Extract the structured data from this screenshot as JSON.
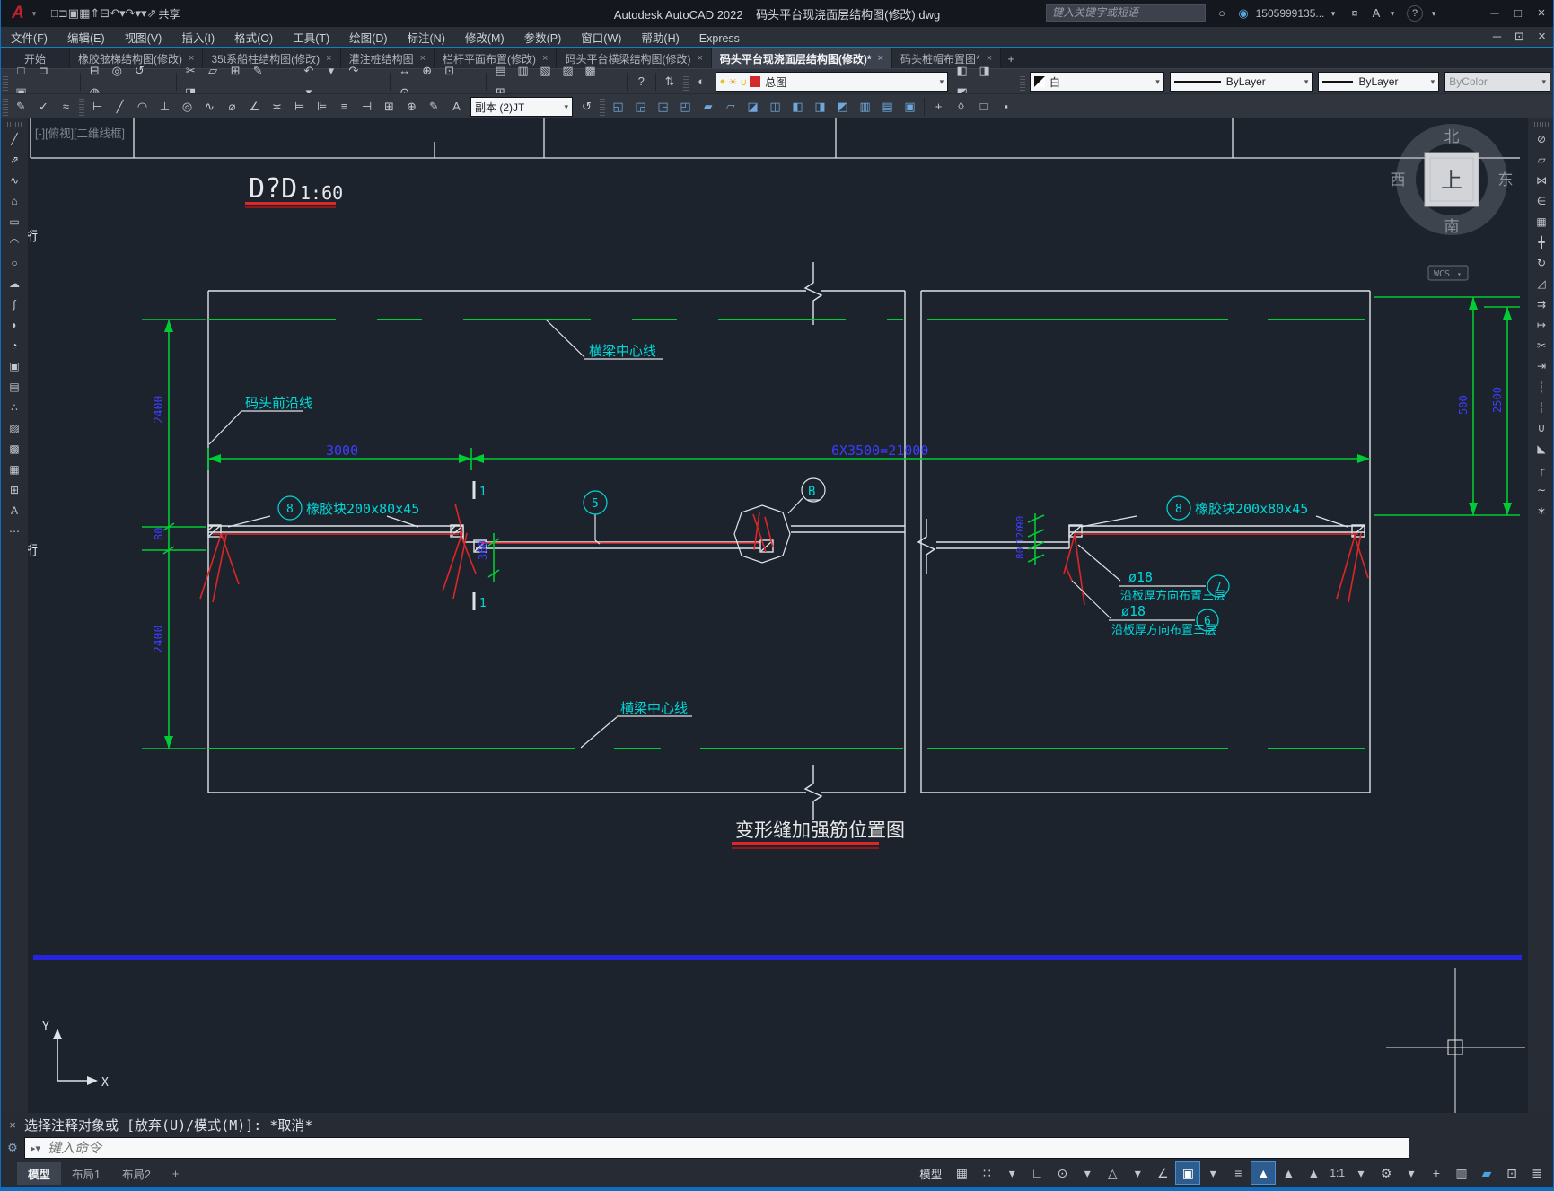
{
  "titlebar": {
    "app_title": "Autodesk AutoCAD 2022",
    "doc_title": "码头平台现浇面层结构图(修改).dwg",
    "share_label": "共享",
    "search_placeholder": "键入关键字或短语",
    "account": "1505999135...",
    "quick_icons": [
      {
        "n": "new-icon",
        "g": "□"
      },
      {
        "n": "open-icon",
        "g": "⊐"
      },
      {
        "n": "save-icon",
        "g": "▣"
      },
      {
        "n": "save-as-icon",
        "g": "▦"
      },
      {
        "n": "export-icon",
        "g": "⇑"
      },
      {
        "n": "plot-icon",
        "g": "⊟"
      },
      {
        "n": "undo-icon",
        "g": "↶"
      },
      {
        "n": "undo-caret-icon",
        "g": "▾"
      },
      {
        "n": "redo-icon",
        "g": "↷"
      },
      {
        "n": "redo-caret-icon",
        "g": "▾"
      },
      {
        "n": "quick-access-caret-icon",
        "g": "▾"
      },
      {
        "n": "share-icon",
        "g": "⇗"
      }
    ],
    "search_icon": "○",
    "account_icon": "◉",
    "cart_icon": "¤",
    "app-store-icon": "A",
    "help_icon": "?",
    "min": "─",
    "max": "□",
    "close": "×"
  },
  "menu": {
    "items": [
      "文件(F)",
      "编辑(E)",
      "视图(V)",
      "插入(I)",
      "格式(O)",
      "工具(T)",
      "绘图(D)",
      "标注(N)",
      "修改(M)",
      "参数(P)",
      "窗口(W)",
      "帮助(H)",
      "Express"
    ],
    "doc_min": "─",
    "doc_restore": "⊡",
    "doc_close": "×"
  },
  "doc_tabs": {
    "close_glyph": "×",
    "tabs": [
      {
        "label": "开始"
      },
      {
        "label": "橡胶舷梯结构图(修改)"
      },
      {
        "label": "35t系船柱结构图(修改)"
      },
      {
        "label": "灌注桩结构图"
      },
      {
        "label": "栏杆平面布置(修改)"
      },
      {
        "label": "码头平台横梁结构图(修改)"
      },
      {
        "label": "码头平台现浇面层结构图(修改)*"
      },
      {
        "label": "码头桩帽布置图*"
      }
    ],
    "new_tab": "+"
  },
  "toolbar1": {
    "g_file": [
      {
        "n": "new-icon",
        "g": "□"
      },
      {
        "n": "open-icon",
        "g": "⊐"
      },
      {
        "n": "save-icon",
        "g": "▣"
      }
    ],
    "g_plot": [
      {
        "n": "plot-icon",
        "g": "⊟"
      },
      {
        "n": "plot-preview-icon",
        "g": "◎"
      },
      {
        "n": "publish-icon",
        "g": "↺"
      },
      {
        "n": "share-view-icon",
        "g": "◍"
      }
    ],
    "g_clip": [
      {
        "n": "cut-icon",
        "g": "✂"
      },
      {
        "n": "copy-clip-icon",
        "g": "▱"
      },
      {
        "n": "paste-icon",
        "g": "⊞"
      },
      {
        "n": "match-properties-icon",
        "g": "✎"
      },
      {
        "n": "block-editor-icon",
        "g": "◨"
      }
    ],
    "g_undo": [
      {
        "n": "undo-icon",
        "g": "↶"
      },
      {
        "n": "undo-caret-icon",
        "g": "▾"
      },
      {
        "n": "redo-icon",
        "g": "↷"
      },
      {
        "n": "redo-caret-icon",
        "g": "▾"
      }
    ],
    "g_zoom": [
      {
        "n": "pan-icon",
        "g": "↔"
      },
      {
        "n": "zoom-realtime-icon",
        "g": "⊕"
      },
      {
        "n": "zoom-window-icon",
        "g": "⊡"
      },
      {
        "n": "zoom-previous-icon",
        "g": "⊙"
      }
    ],
    "g_palettes": [
      {
        "n": "layer-properties-icon",
        "g": "▤"
      },
      {
        "n": "layer-states-icon",
        "g": "▥"
      },
      {
        "n": "properties-palette-icon",
        "g": "▧"
      },
      {
        "n": "tool-palettes-icon",
        "g": "▨"
      },
      {
        "n": "sheet-set-icon",
        "g": "▩"
      },
      {
        "n": "quickcalc-icon",
        "g": "⊞"
      }
    ],
    "g_help": [
      {
        "n": "help-icon",
        "g": "?"
      }
    ],
    "g_sync": [
      {
        "n": "sync-icon",
        "g": "⇅"
      }
    ],
    "g_layer_tool": [
      {
        "n": "make-object-layer-current-icon",
        "g": "◐"
      }
    ],
    "layer_combo": {
      "bulb": "●",
      "sun": "☀",
      "lock": "∪",
      "value": "总图",
      "swatch_color": "#d42a2a"
    },
    "g_layer_tools2": [
      {
        "n": "layer-match-icon",
        "g": "◧"
      },
      {
        "n": "layer-previous-icon",
        "g": "◨"
      },
      {
        "n": "layer-isolate-icon",
        "g": "◩"
      }
    ],
    "color_combo": {
      "value": "白"
    },
    "linetype_combo": {
      "value": "ByLayer"
    },
    "lineweight_combo": {
      "value": "ByLayer"
    },
    "plotstyle_combo": {
      "value": "ByColor"
    }
  },
  "toolbar2": {
    "g_text": [
      {
        "n": "text-edit-icon",
        "g": "✎"
      },
      {
        "n": "spell-check-icon",
        "g": "✓"
      },
      {
        "n": "text-scale-icon",
        "g": "≈"
      }
    ],
    "g_dims": [
      {
        "n": "dim-linear-icon",
        "g": "⊢"
      },
      {
        "n": "dim-aligned-icon",
        "g": "╱"
      },
      {
        "n": "dim-arc-length-icon",
        "g": "◠"
      },
      {
        "n": "dim-ordinate-icon",
        "g": "⊥"
      },
      {
        "n": "dim-radius-icon",
        "g": "◎"
      },
      {
        "n": "dim-jogged-icon",
        "g": "∿"
      },
      {
        "n": "dim-diameter-icon",
        "g": "⌀"
      },
      {
        "n": "dim-angular-icon",
        "g": "∠"
      },
      {
        "n": "dim-quick-icon",
        "g": "≍"
      },
      {
        "n": "dim-baseline-icon",
        "g": "⊨"
      },
      {
        "n": "dim-continue-icon",
        "g": "⊫"
      },
      {
        "n": "dim-space-icon",
        "g": "≡"
      },
      {
        "n": "dim-break-icon",
        "g": "⊣"
      },
      {
        "n": "dim-tolerance-icon",
        "g": "⊞"
      },
      {
        "n": "dim-center-mark-icon",
        "g": "⊕"
      },
      {
        "n": "dim-edit-icon",
        "g": "✎"
      },
      {
        "n": "dim-text-edit-icon",
        "g": "A"
      }
    ],
    "dim_style": "副本 (2)JT",
    "g_update": [
      {
        "n": "dim-update-icon",
        "g": "↺"
      }
    ],
    "g_modify": [
      {
        "n": "union-icon",
        "g": "◱"
      },
      {
        "n": "subtract-icon",
        "g": "◲"
      },
      {
        "n": "intersect-icon",
        "g": "◳"
      },
      {
        "n": "extrude-faces-icon",
        "g": "◰"
      },
      {
        "n": "move-faces-icon",
        "g": "▰"
      },
      {
        "n": "offset-faces-icon",
        "g": "▱"
      },
      {
        "n": "delete-faces-icon",
        "g": "◪"
      },
      {
        "n": "copy-faces-icon",
        "g": "◫"
      },
      {
        "n": "color-faces-icon",
        "g": "◧"
      },
      {
        "n": "shell-icon",
        "g": "◨"
      },
      {
        "n": "clean-icon",
        "g": "◩"
      },
      {
        "n": "separate-icon",
        "g": "▥"
      },
      {
        "n": "imprint-icon",
        "g": "▤"
      },
      {
        "n": "check-icon",
        "g": "▣"
      }
    ],
    "g_end": [
      {
        "n": "interfere-icon",
        "g": "+"
      },
      {
        "n": "section-plane-icon",
        "g": "◊"
      },
      {
        "n": "flatshot-icon",
        "g": "□"
      },
      {
        "n": "live-section-icon",
        "g": "▪"
      }
    ]
  },
  "left_toolbar": {
    "items": [
      {
        "n": "line-icon",
        "g": "╱"
      },
      {
        "n": "construction-line-icon",
        "g": "⇗"
      },
      {
        "n": "polyline-icon",
        "g": "∿"
      },
      {
        "n": "polygon-icon",
        "g": "⌂"
      },
      {
        "n": "rectangle-icon",
        "g": "▭"
      },
      {
        "n": "arc-icon",
        "g": "◠"
      },
      {
        "n": "circle-icon",
        "g": "○"
      },
      {
        "n": "revision-cloud-icon",
        "g": "☁"
      },
      {
        "n": "spline-icon",
        "g": "∫"
      },
      {
        "n": "ellipse-icon",
        "g": "◗"
      },
      {
        "n": "ellipse-arc-icon",
        "g": "◔"
      },
      {
        "n": "insert-block-icon",
        "g": "▣"
      },
      {
        "n": "make-block-icon",
        "g": "▤"
      },
      {
        "n": "point-icon",
        "g": "∴"
      },
      {
        "n": "hatch-icon",
        "g": "▨"
      },
      {
        "n": "gradient-icon",
        "g": "▩"
      },
      {
        "n": "region-icon",
        "g": "▦"
      },
      {
        "n": "table-icon",
        "g": "⊞"
      },
      {
        "n": "multiline-text-icon",
        "g": "A"
      },
      {
        "n": "add-selected-icon",
        "g": "⋯"
      }
    ]
  },
  "right_toolbar": {
    "items": [
      {
        "n": "erase-icon",
        "g": "⊘"
      },
      {
        "n": "copy-icon",
        "g": "▱"
      },
      {
        "n": "mirror-icon",
        "g": "⋈"
      },
      {
        "n": "offset-icon",
        "g": "∈"
      },
      {
        "n": "array-icon",
        "g": "▦"
      },
      {
        "n": "move-icon",
        "g": "╋"
      },
      {
        "n": "rotate-icon",
        "g": "↻"
      },
      {
        "n": "scale-icon",
        "g": "◿"
      },
      {
        "n": "stretch-icon",
        "g": "⇉"
      },
      {
        "n": "lengthen-icon",
        "g": "↦"
      },
      {
        "n": "trim-icon",
        "g": "✂"
      },
      {
        "n": "extend-icon",
        "g": "⇥"
      },
      {
        "n": "break-at-point-icon",
        "g": "┆"
      },
      {
        "n": "break-icon",
        "g": "╎"
      },
      {
        "n": "join-icon",
        "g": "∪"
      },
      {
        "n": "chamfer-icon",
        "g": "◣"
      },
      {
        "n": "fillet-icon",
        "g": "╭"
      },
      {
        "n": "blend-curves-icon",
        "g": "∼"
      },
      {
        "n": "explode-icon",
        "g": "∗"
      }
    ]
  },
  "viewcube": {
    "north": "北",
    "south": "南",
    "west": "西",
    "east": "东",
    "top": "上",
    "wcs": "WCS",
    "wcs_caret": "▾"
  },
  "canvas": {
    "viewport_label": "[-][俯视][二维线框]",
    "section_label": "D?D",
    "section_scale": "1:60",
    "drawing_title": "变形缝加强筋位置图",
    "clipped_text": "桁",
    "labels": {
      "beam_centerline": "横梁中心线",
      "wharf_front_line": "码头前沿线",
      "rubber_block": "橡胶块200x80x45",
      "dia18": "ø18",
      "note_three_layers": "沿板厚方向布置三层"
    },
    "bubbles": {
      "b5": "5",
      "b6": "6",
      "b7": "7",
      "b8": "8",
      "bB": "B",
      "section": "1"
    },
    "dims": {
      "left_top": "2400",
      "left_mid": "80",
      "left_bottom": "2400",
      "span_left": "3000",
      "span_right": "6X3500=21000",
      "recess": "360",
      "joint": [
        "90",
        "120",
        "80"
      ],
      "right_inner": "500",
      "right_outer": "2500"
    },
    "ucs": {
      "x": "X",
      "y": "Y"
    }
  },
  "command": {
    "close_glyph": "×",
    "wrench_glyph": "⚙",
    "prompt_glyph": "▸▾",
    "history": "选择注释对象或 [放弃(U)/模式(M)]: *取消*",
    "placeholder": "键入命令"
  },
  "layout_tabs": {
    "tabs": [
      "模型",
      "布局1",
      "布局2"
    ],
    "new_tab": "+"
  },
  "statusbar": {
    "model": "模型",
    "scale": "1:1",
    "icons_a": [
      {
        "n": "grid-icon",
        "g": "▦"
      },
      {
        "n": "snap-icon",
        "g": "∷"
      },
      {
        "n": "snap-caret-icon",
        "g": "▾"
      },
      {
        "n": "ortho-icon",
        "g": "∟"
      },
      {
        "n": "polar-tracking-icon",
        "g": "⊙"
      },
      {
        "n": "polar-caret-icon",
        "g": "▾"
      },
      {
        "n": "isodraft-icon",
        "g": "△"
      },
      {
        "n": "isodraft-caret-icon",
        "g": "▾"
      },
      {
        "n": "object-snap-tracking-icon",
        "g": "∠"
      },
      {
        "n": "object-snap-icon",
        "g": "▣",
        "on": true
      },
      {
        "n": "osnap-caret-icon",
        "g": "▾"
      },
      {
        "n": "lineweight-display-icon",
        "g": "≡"
      },
      {
        "n": "annotation-visibility-icon",
        "g": "▲",
        "on": true
      },
      {
        "n": "annotation-autoscale-icon",
        "g": "▲"
      },
      {
        "n": "annotation-scale-icon",
        "g": "▲"
      }
    ],
    "icons_b": [
      {
        "n": "scale-caret-icon",
        "g": "▾"
      },
      {
        "n": "workspace-gear-icon",
        "g": "⚙"
      },
      {
        "n": "gear-caret-icon",
        "g": "▾"
      },
      {
        "n": "annotation-monitor-icon",
        "g": "+"
      },
      {
        "n": "isolate-objects-icon",
        "g": "▥"
      },
      {
        "n": "graphics-performance-icon",
        "g": "▰",
        "c": "#4aa3dd"
      },
      {
        "n": "clean-screen-icon",
        "g": "⊡"
      },
      {
        "n": "customization-menu-icon",
        "g": "≣"
      }
    ]
  },
  "accent": {
    "green": "#00cc33",
    "cyan": "#00d8d8",
    "blue_dim_text": "#3d3dff",
    "red": "#dd2626",
    "white_line": "#dfe3e8",
    "polyline_blue": "#2525e0"
  }
}
